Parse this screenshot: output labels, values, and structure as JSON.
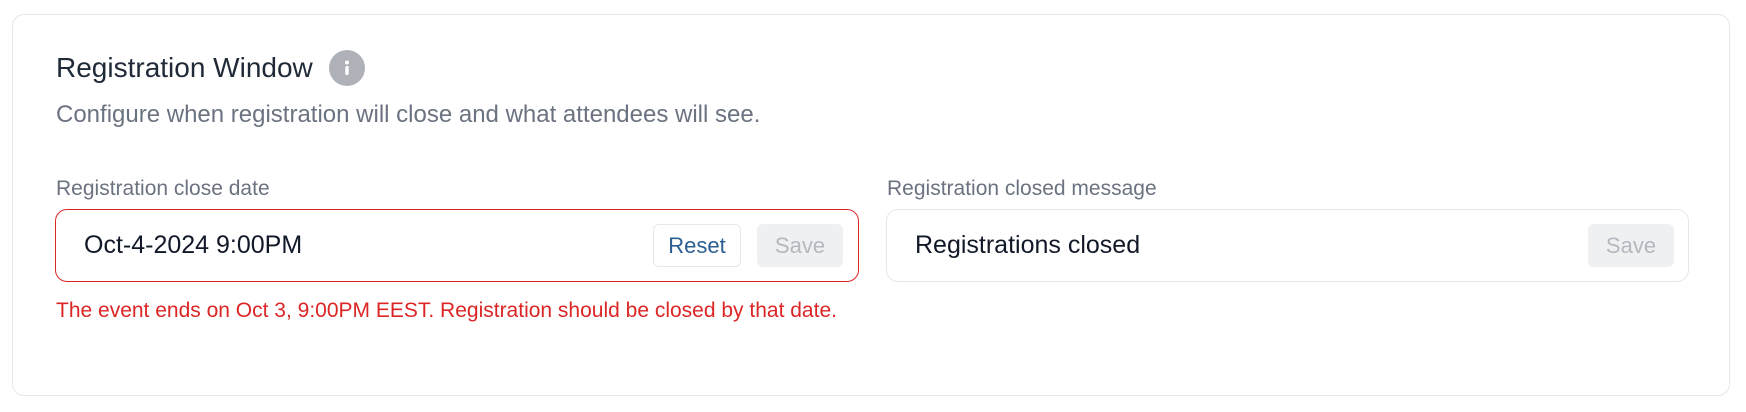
{
  "section": {
    "title": "Registration Window",
    "subtitle": "Configure when registration will close and what attendees will see."
  },
  "close_date": {
    "label": "Registration close date",
    "value": "Oct-4-2024 9:00PM",
    "reset_label": "Reset",
    "save_label": "Save",
    "error": "The event ends on Oct 3, 9:00PM EEST. Registration should be closed by that date."
  },
  "closed_message": {
    "label": "Registration closed message",
    "value": "Registrations closed",
    "save_label": "Save"
  },
  "colors": {
    "error": "#dc2626",
    "link": "#2b5e92",
    "muted": "#6b7280"
  }
}
